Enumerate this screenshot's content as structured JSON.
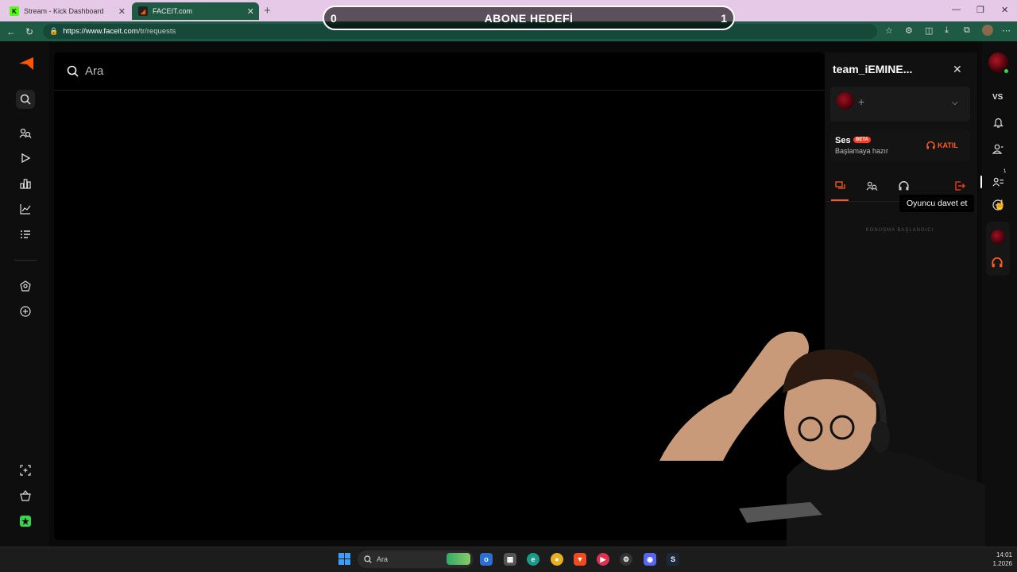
{
  "browser": {
    "tabs": [
      {
        "title": "Stream - Kick Dashboard",
        "favicon": "K"
      },
      {
        "title": "FACEIT.com",
        "favicon": "◢"
      }
    ],
    "new_tab": "+",
    "url_host": "https://www.faceit.com",
    "url_path": "/tr/requests"
  },
  "overlay": {
    "goal_title": "ABONE HEDEFİ",
    "goal_current": "0",
    "goal_target": "1"
  },
  "search": {
    "placeholder": "Ara"
  },
  "party": {
    "team_name": "team_iEMINE...",
    "voice_title": "Ses",
    "beta": "BETA",
    "voice_status": "Başlamaya hazır",
    "join_label": "KATIL",
    "conversation_start": "KONUŞMA BAŞLANGICI"
  },
  "right_rail": {
    "vs_label": "VS",
    "badge_count": "1"
  },
  "tooltip": {
    "text": "Oyuncu davet et"
  },
  "taskbar": {
    "search_placeholder": "Ara",
    "time": "14:01",
    "date": "1.2026"
  },
  "colors": {
    "accent": "#ff5a1f",
    "online": "#32d74b",
    "browser_chrome": "#1f5a44",
    "tabstrip": "#e6c9e6"
  }
}
